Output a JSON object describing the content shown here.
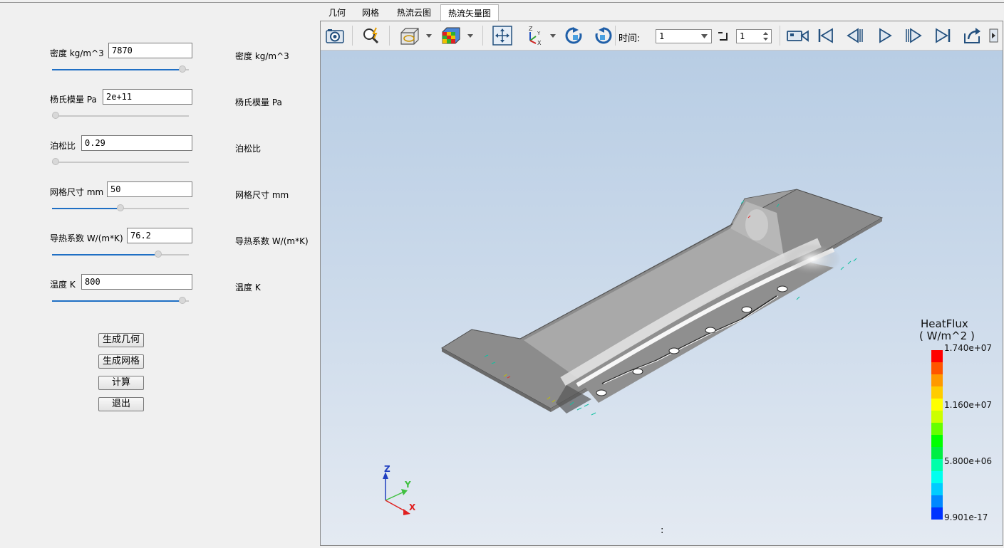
{
  "tabs": [
    "几何",
    "网格",
    "热流云图",
    "热流矢量图"
  ],
  "active_tab": 3,
  "params": [
    {
      "label": "密度 kg/m^3",
      "value": "7870",
      "right_label": "密度 kg/m^3",
      "slider": 0.98
    },
    {
      "label": "杨氏模量 Pa",
      "value": "2e+11",
      "right_label": "杨氏模量 Pa",
      "slider": 0.0
    },
    {
      "label": "泊松比",
      "value": "0.29",
      "right_label": "泊松比",
      "slider": 0.0
    },
    {
      "label": "网格尺寸 mm",
      "value": "50",
      "right_label": "网格尺寸 mm",
      "slider": 0.5
    },
    {
      "label": "导热系数 W/(m*K)",
      "value": "76.2",
      "right_label": "导热系数 W/(m*K)",
      "slider": 0.79
    },
    {
      "label": "温度 K",
      "value": "800",
      "right_label": "温度 K",
      "slider": 0.98
    }
  ],
  "buttons": {
    "geometry": "生成几何",
    "mesh": "生成网格",
    "compute": "计算",
    "exit": "退出"
  },
  "toolbar": {
    "time_label": "时间:",
    "time_value": "1",
    "step_value": "1",
    "icons": [
      "camera-icon",
      "zoom-icon",
      "view-box-icon",
      "colormap-cube-icon",
      "fit-view-icon",
      "axes-icon",
      "rotate-cw-icon",
      "rotate-ccw-icon",
      "record-video-icon",
      "first-frame-icon",
      "prev-frame-icon",
      "play-icon",
      "next-frame-icon",
      "last-frame-icon",
      "export-icon"
    ]
  },
  "legend": {
    "title": "HeatFlux",
    "unit": "( W/m^2 )",
    "max": "1.740e+07",
    "v2": "1.160e+07",
    "v3": "5.800e+06",
    "min": "9.901e-17",
    "colors": [
      "#ff0000",
      "#ff5500",
      "#ff9900",
      "#ffcc00",
      "#ffff00",
      "#ccff00",
      "#66ff00",
      "#00ff00",
      "#00ee44",
      "#00ffaa",
      "#00ffee",
      "#00ccff",
      "#0088ff",
      "#0033ff"
    ]
  },
  "axes": {
    "x": "X",
    "y": "Y",
    "z": "Z"
  },
  "status_text": ":"
}
